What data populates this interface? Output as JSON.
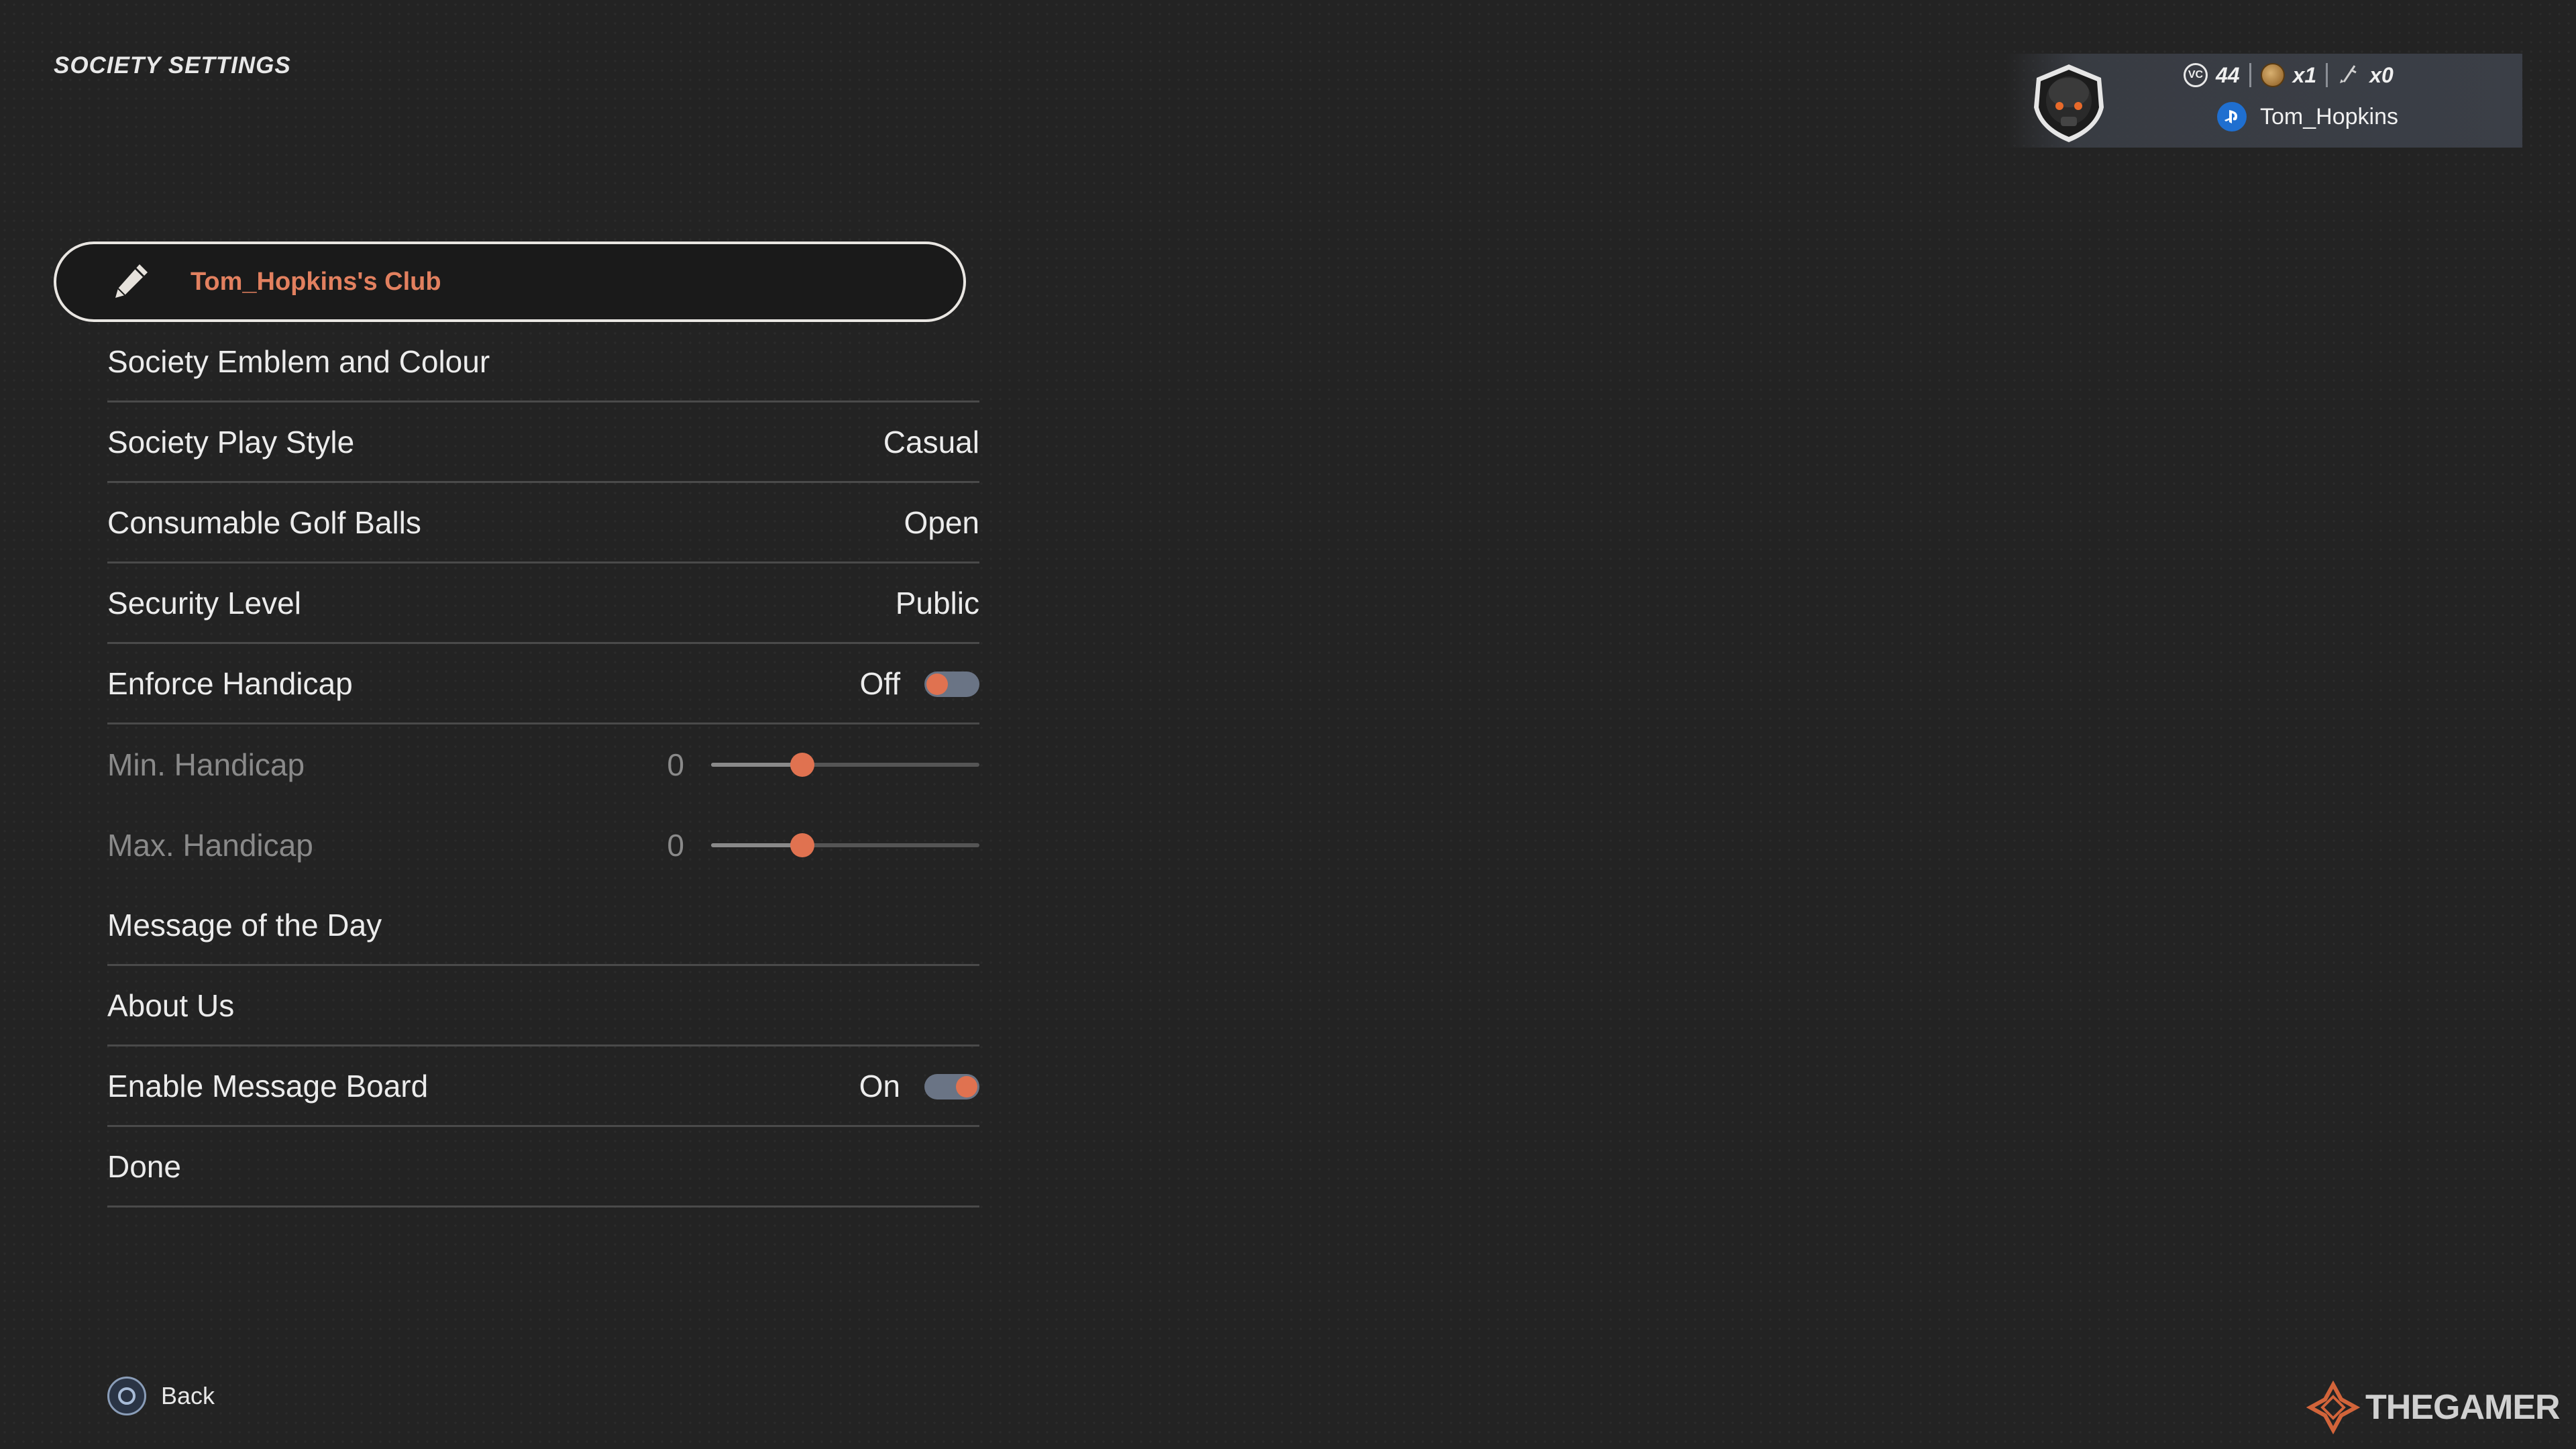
{
  "page": {
    "title": "SOCIETY SETTINGS"
  },
  "profile": {
    "vc_icon_text": "VC",
    "vc_amount": "44",
    "coins": "x1",
    "clubs": "x0",
    "username": "Tom_Hopkins"
  },
  "menu": {
    "club_name": "Tom_Hopkins's Club",
    "items": [
      {
        "label": "Society Emblem and Colour",
        "value": ""
      },
      {
        "label": "Society Play Style",
        "value": "Casual"
      },
      {
        "label": "Consumable Golf Balls",
        "value": "Open"
      },
      {
        "label": "Security Level",
        "value": "Public"
      },
      {
        "label": "Enforce Handicap",
        "value": "Off",
        "toggle": false
      },
      {
        "label": "Min. Handicap",
        "value": "0",
        "slider_fraction": 0.34
      },
      {
        "label": "Max. Handicap",
        "value": "0",
        "slider_fraction": 0.34
      },
      {
        "label": "Message of the Day",
        "value": ""
      },
      {
        "label": "About Us",
        "value": ""
      },
      {
        "label": "Enable Message Board",
        "value": "On",
        "toggle": true
      },
      {
        "label": "Done",
        "value": ""
      }
    ]
  },
  "footer": {
    "back_label": "Back"
  },
  "watermark": {
    "text": "THEGAMER"
  },
  "colors": {
    "accent": "#e07250",
    "highlight_text": "#e2805f",
    "background": "#232323"
  },
  "icons": [
    "pencil-icon",
    "avatar-helmet-icon",
    "vc-icon",
    "coin-icon",
    "club-icon",
    "playstation-icon",
    "circle-button-icon",
    "thegamer-logo-icon"
  ]
}
